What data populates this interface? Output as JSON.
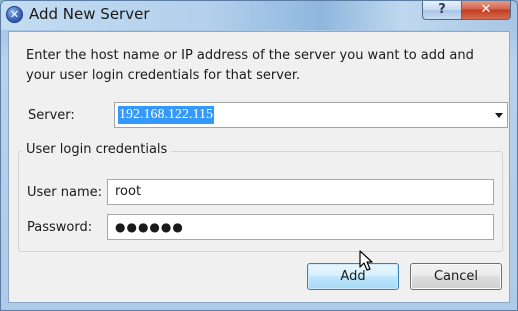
{
  "window": {
    "title": "Add New Server",
    "help_label": "?",
    "close_label": "✕"
  },
  "description": "Enter the host name or IP address of the server you want to add and your user login credentials for that server.",
  "server": {
    "label": "Server:",
    "value": "192.168.122.115"
  },
  "credentials": {
    "legend": "User login credentials",
    "username_label": "User name:",
    "username_value": "root",
    "password_label": "Password:",
    "password_value": "●●●●●●"
  },
  "buttons": {
    "add_label": "Add",
    "cancel_label": "Cancel"
  },
  "icons": [
    "app-icon",
    "help-icon",
    "close-icon",
    "dropdown-arrow-icon",
    "mouse-cursor-icon"
  ],
  "colors": {
    "selection": "#3399ff",
    "title_bar": "#b3d0ec",
    "close_button": "#c23d22",
    "default_button_border": "#3c7fb1"
  }
}
